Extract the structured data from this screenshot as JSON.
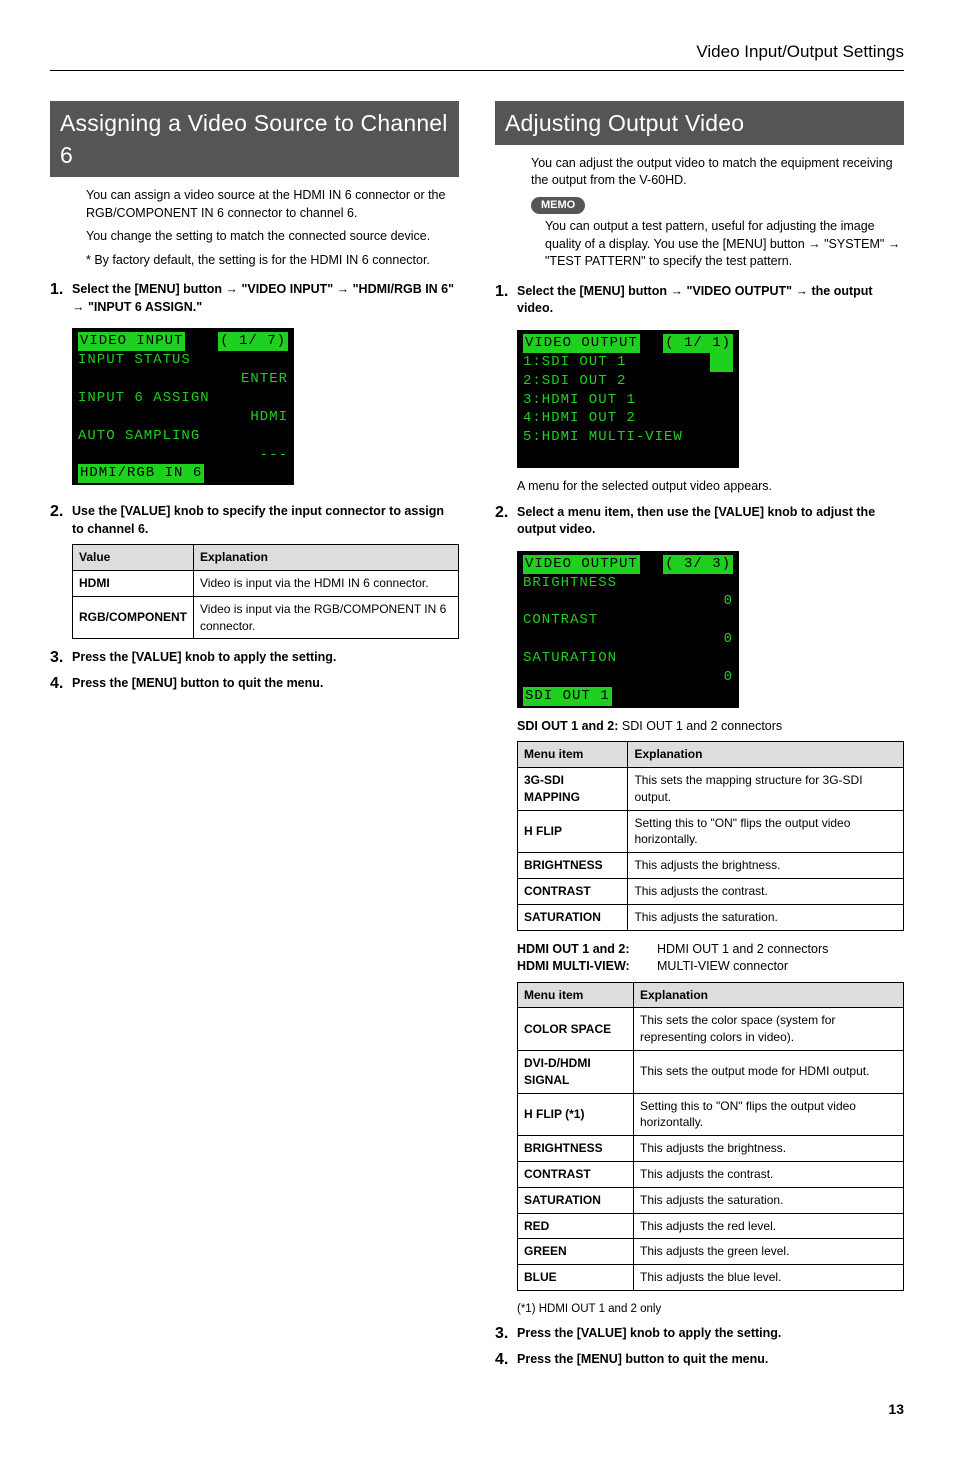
{
  "header": {
    "section": "Video Input/Output Settings"
  },
  "left": {
    "title": "Assigning a Video Source to Channel 6",
    "intro1": "You can assign a video source at the HDMI IN 6 connector or the RGB/COMPONENT IN 6 connector to channel 6.",
    "intro2": "You change the setting to match the connected source device.",
    "intro3": "*  By factory default, the setting is for the HDMI IN 6 connector.",
    "step1": "Select the [MENU] button → \"VIDEO INPUT\" → \"HDMI/RGB IN 6\" → \"INPUT 6 ASSIGN.\"",
    "lcd1": {
      "title_l": "VIDEO INPUT",
      "title_r": "( 1/ 7)",
      "l1": "INPUT STATUS",
      "l1v": "ENTER",
      "l2": "INPUT 6 ASSIGN",
      "l2v": "HDMI",
      "l3": "AUTO SAMPLING",
      "l3v": "---",
      "foot": "HDMI/RGB IN 6"
    },
    "step2": "Use the [VALUE] knob to specify the input connector to assign to channel 6.",
    "table": {
      "h1": "Value",
      "h2": "Explanation",
      "r1k": "HDMI",
      "r1v": "Video is input via the HDMI IN 6 connector.",
      "r2k": "RGB/COMPONENT",
      "r2v": "Video is input via the RGB/COMPONENT IN 6 connector."
    },
    "step3": "Press the [VALUE] knob to apply the setting.",
    "step4": "Press the [MENU] button to quit the menu."
  },
  "right": {
    "title": "Adjusting Output Video",
    "intro1": "You can adjust the output video to match the equipment receiving the output from the V-60HD.",
    "memo_label": "MEMO",
    "memo": "You can output a test pattern, useful for adjusting the image quality of a display. You use the [MENU] button → \"SYSTEM\" → \"TEST PATTERN\" to specify the test pattern.",
    "step1": "Select the [MENU] button → \"VIDEO OUTPUT\" → the output video.",
    "lcd1": {
      "title_l": "VIDEO OUTPUT",
      "title_r": "( 1/ 1)",
      "l1": "1:SDI OUT 1",
      "l2": "2:SDI OUT 2",
      "l3": "3:HDMI OUT 1",
      "l4": "4:HDMI OUT 2",
      "l5": "5:HDMI MULTI-VIEW"
    },
    "after_lcd1": "A menu for the selected output video appears.",
    "step2": "Select a menu item, then use the [VALUE] knob to adjust the output video.",
    "lcd2": {
      "title_l": "VIDEO OUTPUT",
      "title_r": "( 3/ 3)",
      "l1": "BRIGHTNESS",
      "l1v": "0",
      "l2": "CONTRAST",
      "l2v": "0",
      "l3": "SATURATION",
      "l3v": "0",
      "foot": "SDI OUT 1"
    },
    "sdi_heading_k": "SDI OUT 1 and 2:",
    "sdi_heading_v": "SDI OUT 1 and 2 connectors",
    "table1": {
      "h1": "Menu item",
      "h2": "Explanation",
      "rows": [
        {
          "k": "3G-SDI MAPPING",
          "v": "This sets the mapping structure for 3G-SDI output."
        },
        {
          "k": "H FLIP",
          "v": "Setting this to \"ON\" flips the output video horizontally."
        },
        {
          "k": "BRIGHTNESS",
          "v": "This adjusts the brightness."
        },
        {
          "k": "CONTRAST",
          "v": "This adjusts the contrast."
        },
        {
          "k": "SATURATION",
          "v": "This adjusts the saturation."
        }
      ]
    },
    "hdmi_heading1_k": "HDMI OUT 1 and 2:",
    "hdmi_heading1_v": "HDMI OUT 1 and 2 connectors",
    "hdmi_heading2_k": "HDMI MULTI-VIEW:",
    "hdmi_heading2_v": "MULTI-VIEW connector",
    "table2": {
      "h1": "Menu item",
      "h2": "Explanation",
      "rows": [
        {
          "k": "COLOR SPACE",
          "v": "This sets the color space (system for representing colors in video)."
        },
        {
          "k": "DVI-D/HDMI SIGNAL",
          "v": "This sets the output mode for HDMI output."
        },
        {
          "k": "H FLIP (*1)",
          "v": "Setting this to \"ON\" flips the output video horizontally."
        },
        {
          "k": "BRIGHTNESS",
          "v": "This adjusts the brightness."
        },
        {
          "k": "CONTRAST",
          "v": "This adjusts the contrast."
        },
        {
          "k": "SATURATION",
          "v": "This adjusts the saturation."
        },
        {
          "k": "RED",
          "v": "This adjusts the red level."
        },
        {
          "k": "GREEN",
          "v": "This adjusts the green level."
        },
        {
          "k": "BLUE",
          "v": "This adjusts the blue level."
        }
      ]
    },
    "footnote": "(*1) HDMI OUT 1 and 2 only",
    "step3": "Press the [VALUE] knob to apply the setting.",
    "step4": "Press the [MENU] button to quit the menu."
  },
  "page": "13"
}
